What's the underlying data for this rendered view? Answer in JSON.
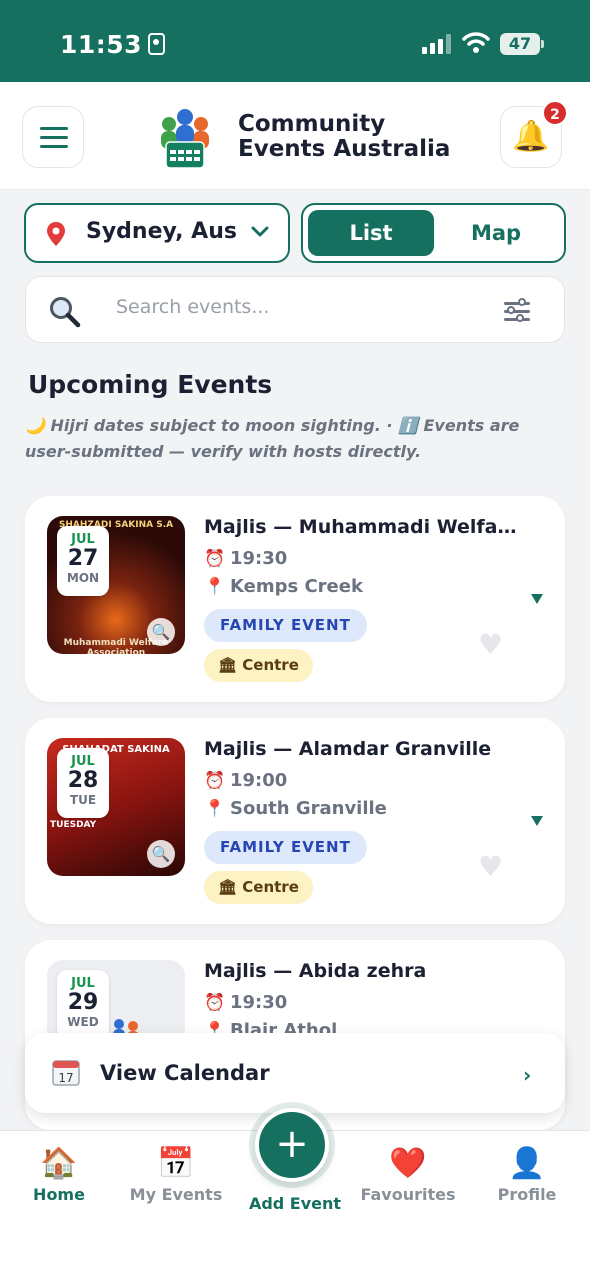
{
  "status_bar": {
    "time": "11:53",
    "battery": "47"
  },
  "header": {
    "brand_line1": "Community",
    "brand_line2": "Events Australia",
    "notification_count": "2"
  },
  "controls": {
    "location": "Sydney, Australia",
    "view_options": [
      "List",
      "Map"
    ],
    "active_view": "List",
    "search_placeholder": "Search events..."
  },
  "section": {
    "title": "Upcoming Events",
    "note": "🌙 Hijri dates subject to moon sighting. · ℹ️ Events are user-submitted — verify with hosts directly."
  },
  "events": [
    {
      "month": "JUL",
      "day": "27",
      "weekday": "MON",
      "title": "Majlis — Muhammadi Welfare Association",
      "time": "19:30",
      "location": "Kemps Creek",
      "tag": "FAMILY EVENT",
      "venue_type": "Centre",
      "poster_top": "SHAHZADI SAKINA S.A",
      "poster_bottom": "Muhammadi Welfare Association"
    },
    {
      "month": "JUL",
      "day": "28",
      "weekday": "TUE",
      "title": "Majlis — Alamdar Granville",
      "time": "19:00",
      "location": "South Granville",
      "tag": "FAMILY EVENT",
      "venue_type": "Centre",
      "poster_top": "SHAHADAT SAKINA",
      "poster_bottom": "TUESDAY"
    },
    {
      "month": "JUL",
      "day": "29",
      "weekday": "WED",
      "title": "Majlis — Abida zehra",
      "time": "19:30",
      "location": "Blair Athol"
    }
  ],
  "calendar_bar": {
    "label": "View Calendar"
  },
  "bottom_nav": {
    "home": "Home",
    "my_events": "My Events",
    "add_event": "Add Event",
    "favourites": "Favourites",
    "profile": "Profile"
  },
  "colors": {
    "primary": "#16705f",
    "badge": "#d92d2d",
    "family_pill": "#dde9fb",
    "centre_pill": "#fdf2c4"
  }
}
